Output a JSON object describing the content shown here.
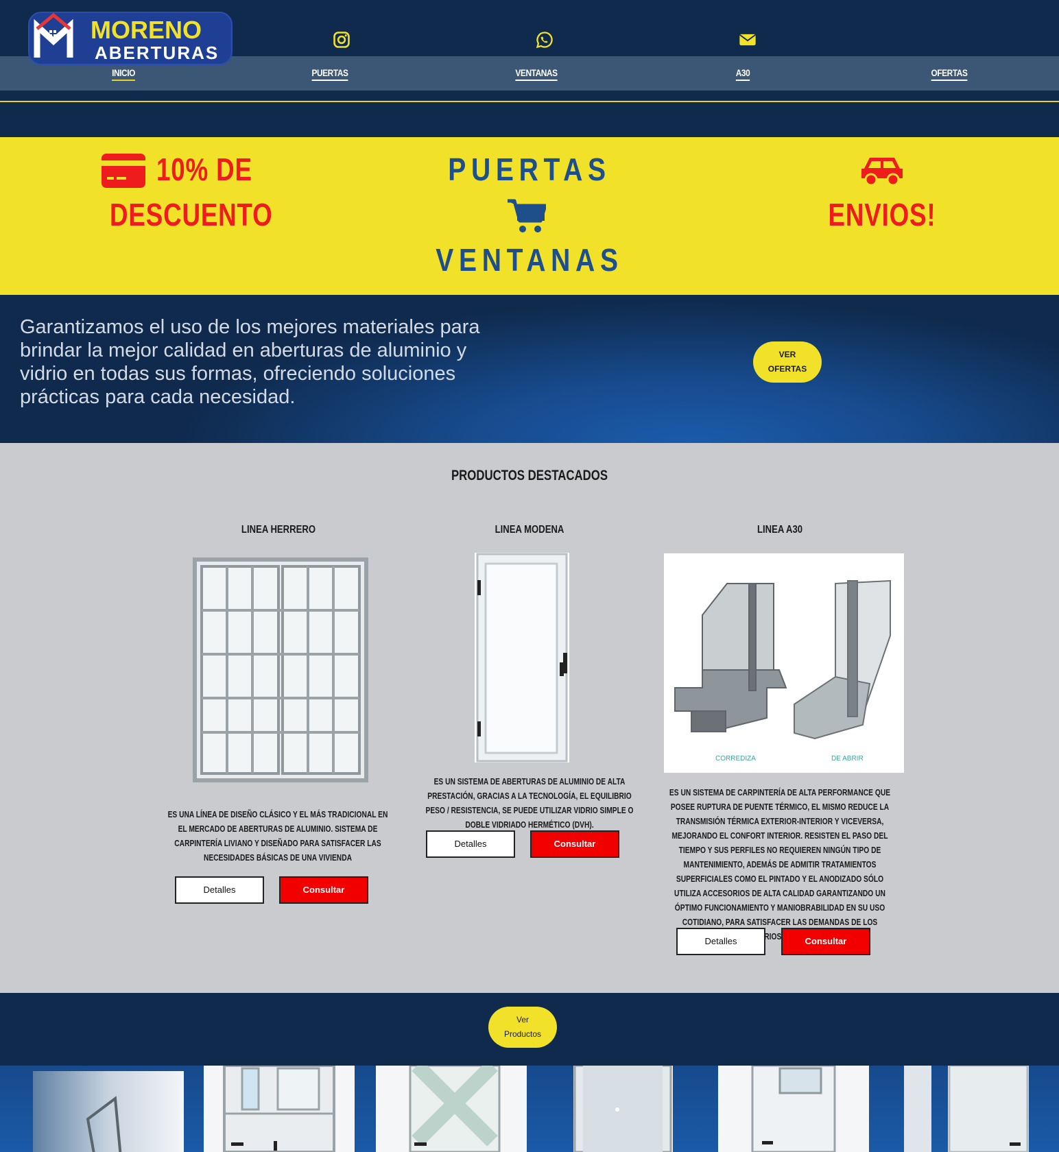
{
  "brand": {
    "line1": "MORENO",
    "line2": "ABERTURAS"
  },
  "top_icons": [
    "instagram-icon",
    "whatsapp-icon",
    "mail-icon"
  ],
  "nav": [
    {
      "label": "INICIO"
    },
    {
      "label": "PUERTAS"
    },
    {
      "label": "VENTANAS"
    },
    {
      "label": "A30"
    },
    {
      "label": "OFERTAS"
    }
  ],
  "promo": {
    "discount_line1": "10% DE",
    "discount_line2": "DESCUENTO",
    "center_line1": "PUERTAS",
    "center_line2": "VENTANAS",
    "shipping": "ENVIOS!"
  },
  "hero": {
    "text": "Garantizamos el uso de los mejores materiales para brindar la mejor calidad en aberturas de aluminio y vidrio en todas sus formas, ofreciendo soluciones prácticas para cada necesidad.",
    "cta_line1": "VER",
    "cta_line2": "OFERTAS"
  },
  "products": {
    "title": "PRODUCTOS DESTACADOS",
    "items": [
      {
        "title": "LINEA HERRERO",
        "description": "ES UNA LÍNEA DE DISEÑO CLÁSICO Y EL MÁS TRADICIONAL EN EL MERCADO DE ABERTURAS DE ALUMINIO. SISTEMA DE CARPINTERÍA LIVIANO Y DISEÑADO PARA SATISFACER LAS NECESIDADES BÁSICAS DE UNA VIVIENDA",
        "details": "Detalles",
        "consult": "Consultar"
      },
      {
        "title": "LINEA MODENA",
        "description": "ES UN SISTEMA DE ABERTURAS DE ALUMINIO DE ALTA PRESTACIÓN, GRACIAS A LA TECNOLOGÍA, EL EQUILIBRIO PESO / RESISTENCIA, SE PUEDE UTILIZAR VIDRIO SIMPLE O DOBLE VIDRIADO HERMÉTICO (DVH).",
        "details": "Detalles",
        "consult": "Consultar"
      },
      {
        "title": "LINEA A30",
        "description": "ES UN SISTEMA DE CARPINTERÍA DE ALTA PERFORMANCE QUE POSEE RUPTURA DE PUENTE TÉRMICO, EL MISMO REDUCE LA TRANSMISIÓN TÉRMICA EXTERIOR-INTERIOR Y VICEVERSA, MEJORANDO EL CONFORT INTERIOR. RESISTEN EL PASO DEL TIEMPO Y SUS PERFILES NO REQUIEREN NINGÚN TIPO DE MANTENIMIENTO, ADEMÁS DE ADMITIR TRATAMIENTOS SUPERFICIALES COMO EL PINTADO Y EL ANODIZADO SÓLO UTILIZA ACCESORIOS DE ALTA CALIDAD GARANTIZANDO UN ÓPTIMO FUNCIONAMIENTO Y MANIOBRABILIDAD EN SU USO COTIDIANO, PARA SATISFACER LAS DEMANDAS DE LOS USUARIOS FINALES.",
        "details": "Detalles",
        "consult": "Consultar",
        "image_labels": [
          "CORREDIZA",
          "DE ABRIR"
        ]
      }
    ]
  },
  "bottom": {
    "cta_line1": "Ver",
    "cta_line2": "Productos"
  },
  "colors": {
    "navy": "#0f2a4d",
    "yellow": "#f1e229",
    "red": "#ee1c1c",
    "blue_text": "#1f4f8a",
    "gray_bg": "#cacbce"
  }
}
